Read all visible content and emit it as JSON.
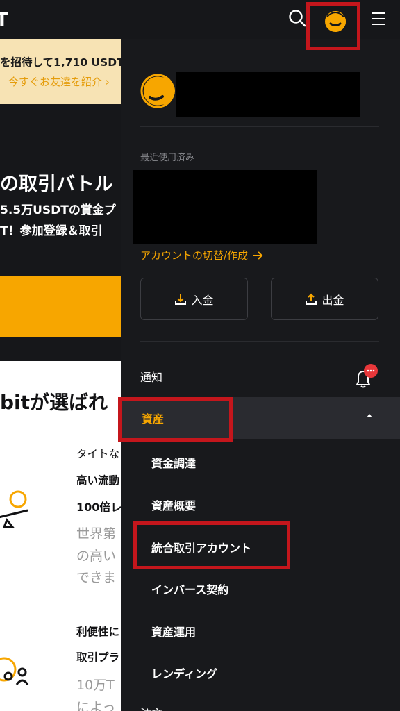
{
  "background": {
    "logo_fragment": "T",
    "promo_line1": "を招待して1,710 USDT",
    "promo_line2": "今すぐお友達を紹介 ›",
    "hero_title": "の取引バトル",
    "hero_sub1": "5.5万USDTの賞金プ",
    "hero_sub2": "T！参加登録＆取引",
    "why_heading": "bitが選ばれ",
    "features": [
      "タイトな",
      "高い流動",
      "100倍レ",
      "世界第",
      "の高い",
      "できま",
      "利便性に",
      "取引プラ",
      "10万T",
      "によっ"
    ]
  },
  "header": {
    "icons": [
      "search-icon",
      "avatar-icon",
      "hamburger-menu-icon"
    ]
  },
  "drawer": {
    "recent_label": "最近使用済み",
    "switch_account_label": "アカウントの切替/作成",
    "deposit_label": "入金",
    "withdraw_label": "出金",
    "notifications_label": "通知",
    "notification_badge": "···",
    "assets_label": "資産",
    "asset_items": [
      "資金調達",
      "資産概要",
      "統合取引アカウント",
      "インバース契約",
      "資産運用",
      "レンディング"
    ],
    "next_partial": "注文"
  },
  "colors": {
    "accent": "#f7a600",
    "drawer_bg": "#18191c",
    "highlight": "#c4161c",
    "badge": "#e8373a"
  }
}
